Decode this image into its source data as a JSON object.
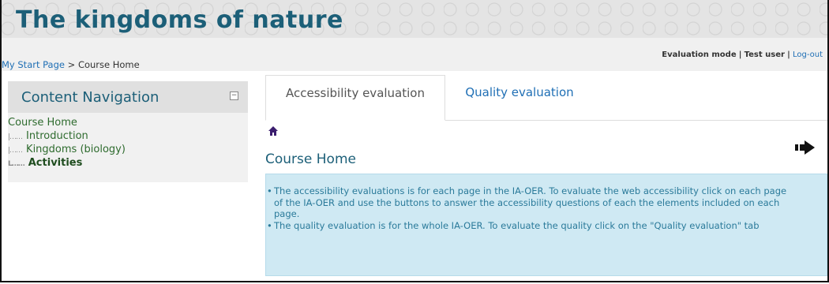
{
  "site": {
    "title": "The kingdoms of nature"
  },
  "user_bar": {
    "mode": "Evaluation mode",
    "sep1": "|",
    "user": "Test user",
    "sep2": "|",
    "logout": "Log-out"
  },
  "breadcrumb": {
    "home": "My Start Page",
    "sep": ">",
    "current": "Course Home"
  },
  "nav": {
    "title": "Content Navigation",
    "home": "Course Home",
    "items": [
      {
        "label": "Introduction"
      },
      {
        "label": "Kingdoms (biology)"
      },
      {
        "label": "Activities"
      }
    ]
  },
  "tabs": [
    {
      "label": "Accessibility evaluation"
    },
    {
      "label": "Quality evaluation"
    }
  ],
  "page": {
    "title": "Course Home",
    "bullets": [
      "The accessibility evaluations is for each page in the IA-OER. To evaluate the web accessibility click on each page of the IA-OER and use the buttons to answer the accessibility questions of each the elements included on each page.",
      "The quality evaluation is for the whole IA-OER. To evaluate the quality click on the \"Quality evaluation\" tab"
    ]
  },
  "icons": {
    "home": "home-icon",
    "next": "next-arrow-icon",
    "collapse": "collapse-icon"
  }
}
